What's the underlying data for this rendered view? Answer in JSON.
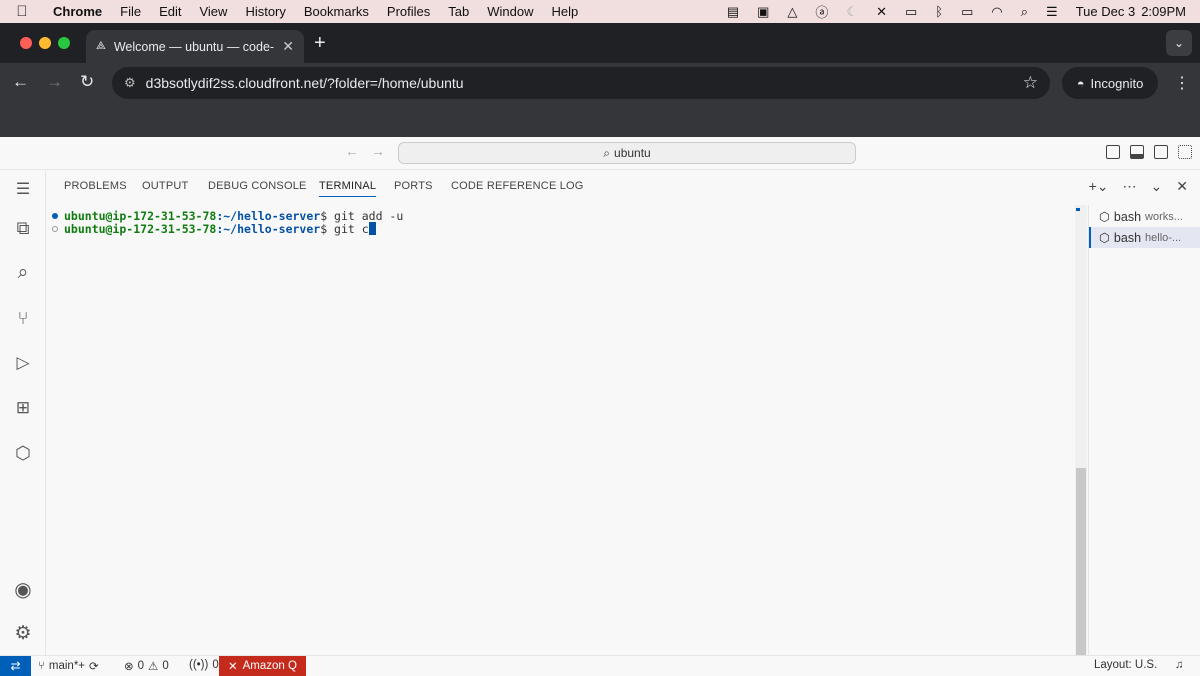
{
  "menubar": {
    "app": "Chrome",
    "items": [
      "File",
      "Edit",
      "View",
      "History",
      "Bookmarks",
      "Profiles",
      "Tab",
      "Window",
      "Help"
    ],
    "date": "Tue Dec 3",
    "time": "2:09PM"
  },
  "browser": {
    "tab_title": "Welcome — ubuntu — code-s",
    "url": "d3bsotlydif2ss.cloudfront.net/?folder=/home/ubuntu",
    "incognito_label": "Incognito"
  },
  "vscode": {
    "command_center": "ubuntu",
    "panel_tabs": [
      "PROBLEMS",
      "OUTPUT",
      "DEBUG CONSOLE",
      "TERMINAL",
      "PORTS",
      "CODE REFERENCE LOG"
    ],
    "active_panel_tab": "TERMINAL",
    "terminal_lines": [
      {
        "user": "ubuntu@ip-172-31-53-78",
        "path": ":~/hello-server",
        "prompt": "$ ",
        "command": "git add -u"
      },
      {
        "user": "ubuntu@ip-172-31-53-78",
        "path": ":~/hello-server",
        "prompt": "$ ",
        "command": "git c"
      }
    ],
    "terminals": [
      {
        "name": "bash",
        "detail": "works..."
      },
      {
        "name": "bash",
        "detail": "hello-..."
      }
    ],
    "status": {
      "branch": "main*+",
      "errors": "0",
      "warnings": "0",
      "ports": "0",
      "amazon_q": "Amazon Q",
      "layout": "Layout: U.S."
    }
  },
  "colors": {
    "accent": "#005fb8",
    "amazon_q_bg": "#c42b1c",
    "terminal_user": "#107c10",
    "terminal_path": "#0451a5"
  }
}
